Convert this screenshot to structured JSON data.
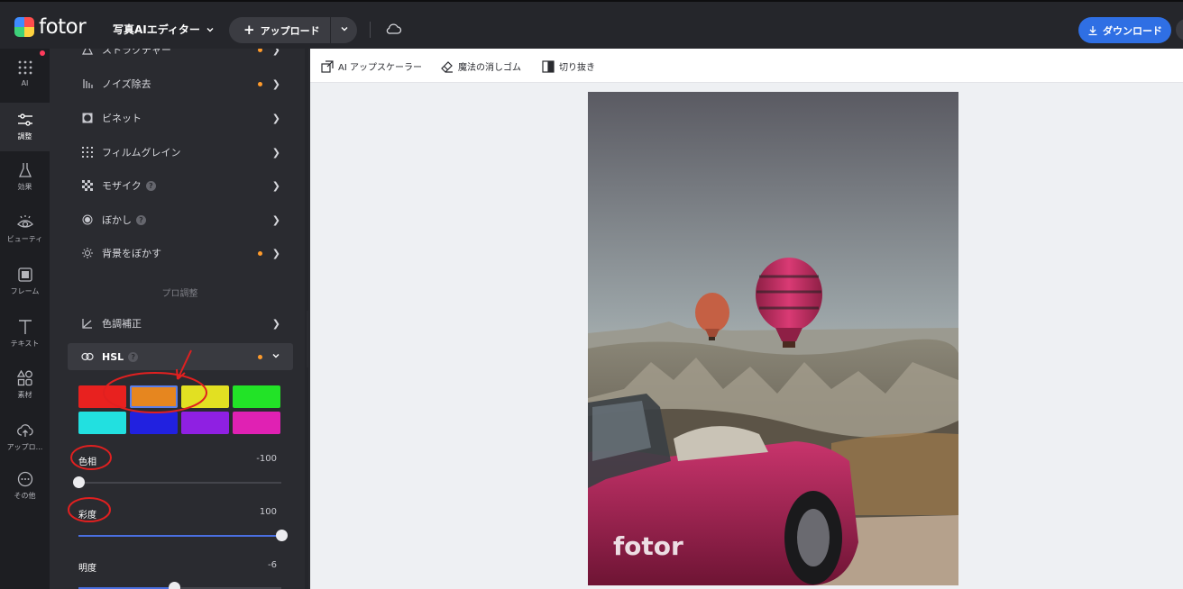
{
  "topbar": {
    "logo_text": "fotor",
    "editor_label": "写真AIエディター",
    "upload_label": "アップロード",
    "download_label": "ダウンロード"
  },
  "rail": {
    "items": [
      {
        "label": "AI",
        "icon": "grid-icon"
      },
      {
        "label": "調整",
        "icon": "sliders-icon"
      },
      {
        "label": "効果",
        "icon": "flask-icon"
      },
      {
        "label": "ビューティ",
        "icon": "eye-icon"
      },
      {
        "label": "フレーム",
        "icon": "frame-icon"
      },
      {
        "label": "テキスト",
        "icon": "text-icon"
      },
      {
        "label": "素材",
        "icon": "shapes-icon"
      },
      {
        "label": "アップロ...",
        "icon": "upload-cloud-icon"
      },
      {
        "label": "その他",
        "icon": "more-icon"
      }
    ]
  },
  "panel": {
    "rows": [
      {
        "label": "ストラクチャー",
        "icon": "triangle-icon",
        "dot": true
      },
      {
        "label": "ノイズ除去",
        "icon": "noise-icon",
        "dot": true
      },
      {
        "label": "ビネット",
        "icon": "vignette-icon",
        "dot": false
      },
      {
        "label": "フィルムグレイン",
        "icon": "grain-icon",
        "dot": false
      },
      {
        "label": "モザイク",
        "icon": "mosaic-icon",
        "dot": false
      },
      {
        "label": "ぼかし",
        "icon": "blur-icon",
        "dot": false
      },
      {
        "label": "背景をぼかす",
        "icon": "bg-blur-icon",
        "dot": true
      }
    ],
    "section_title": "プロ調整",
    "color_row_label": "色調補正",
    "hsl_label": "HSL",
    "swatches": [
      "#e8211f",
      "#e6861f",
      "#e2e022",
      "#22e327",
      "#22e0e0",
      "#2121e0",
      "#8f20e2",
      "#e021b3"
    ],
    "selected_swatch": 1,
    "sliders": [
      {
        "label": "色相",
        "value": "-100",
        "level": 0.0
      },
      {
        "label": "彩度",
        "value": "100",
        "level": 1.0
      },
      {
        "label": "明度",
        "value": "-6",
        "level": 0.47
      }
    ]
  },
  "toolbar": {
    "tools": [
      {
        "label": "AI アップスケーラー",
        "icon": "upscale-icon"
      },
      {
        "label": "魔法の消しゴム",
        "icon": "eraser-icon"
      },
      {
        "label": "切り抜き",
        "icon": "cutout-icon"
      }
    ]
  },
  "photo": {
    "watermark": "fotor"
  },
  "colors": {
    "accent": "#2f6fe4",
    "dot": "#ff9b2b",
    "annotation": "#e02020"
  }
}
